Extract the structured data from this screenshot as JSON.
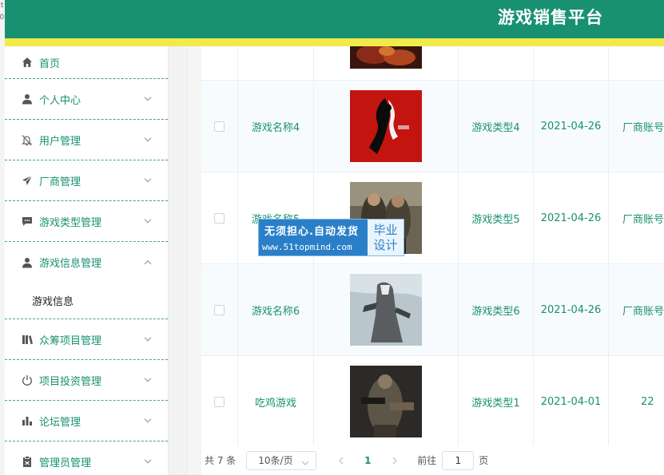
{
  "edge_fragments": [
    "ct",
    "t0",
    "t"
  ],
  "header": {
    "title": "游戏销售平台",
    "color": "#189171",
    "stripe_color": "#f0ea4a"
  },
  "sidebar": {
    "items": [
      {
        "label": "首页",
        "icon": "home-icon"
      },
      {
        "label": "个人中心",
        "icon": "user-icon",
        "chevron": "down"
      },
      {
        "label": "用户管理",
        "icon": "bell-off-icon",
        "chevron": "down"
      },
      {
        "label": "厂商管理",
        "icon": "paper-plane-icon",
        "chevron": "down"
      },
      {
        "label": "游戏类型管理",
        "icon": "message-icon",
        "chevron": "down"
      },
      {
        "label": "游戏信息管理",
        "icon": "user-icon",
        "chevron": "up",
        "expanded": true,
        "children": [
          "游戏信息"
        ]
      },
      {
        "label": "众筹项目管理",
        "icon": "books-icon",
        "chevron": "down"
      },
      {
        "label": "项目投资管理",
        "icon": "power-icon",
        "chevron": "down"
      },
      {
        "label": "论坛管理",
        "icon": "bar-chart-icon",
        "chevron": "down"
      },
      {
        "label": "管理员管理",
        "icon": "clipboard-icon",
        "chevron": "down"
      }
    ]
  },
  "table": {
    "rows": [
      {
        "name": "游戏名称4",
        "type": "游戏类型4",
        "date": "2021-04-26",
        "vendor": "厂商账号"
      },
      {
        "name": "游戏名称5",
        "type": "游戏类型5",
        "date": "2021-04-26",
        "vendor": "厂商账号"
      },
      {
        "name": "游戏名称6",
        "type": "游戏类型6",
        "date": "2021-04-26",
        "vendor": "厂商账号"
      },
      {
        "name": "吃鸡游戏",
        "type": "游戏类型1",
        "date": "2021-04-01",
        "vendor": "22"
      }
    ]
  },
  "pagination": {
    "total": "共 7 条",
    "page_size": "10条/页",
    "current_page": "1",
    "goto_label": "前往",
    "goto_value": "1",
    "page_suffix": "页"
  },
  "watermark": {
    "main": "无须担心.自动发货",
    "url": "www.51topmind.com",
    "box_line1": "毕业",
    "box_line2": "设计"
  }
}
